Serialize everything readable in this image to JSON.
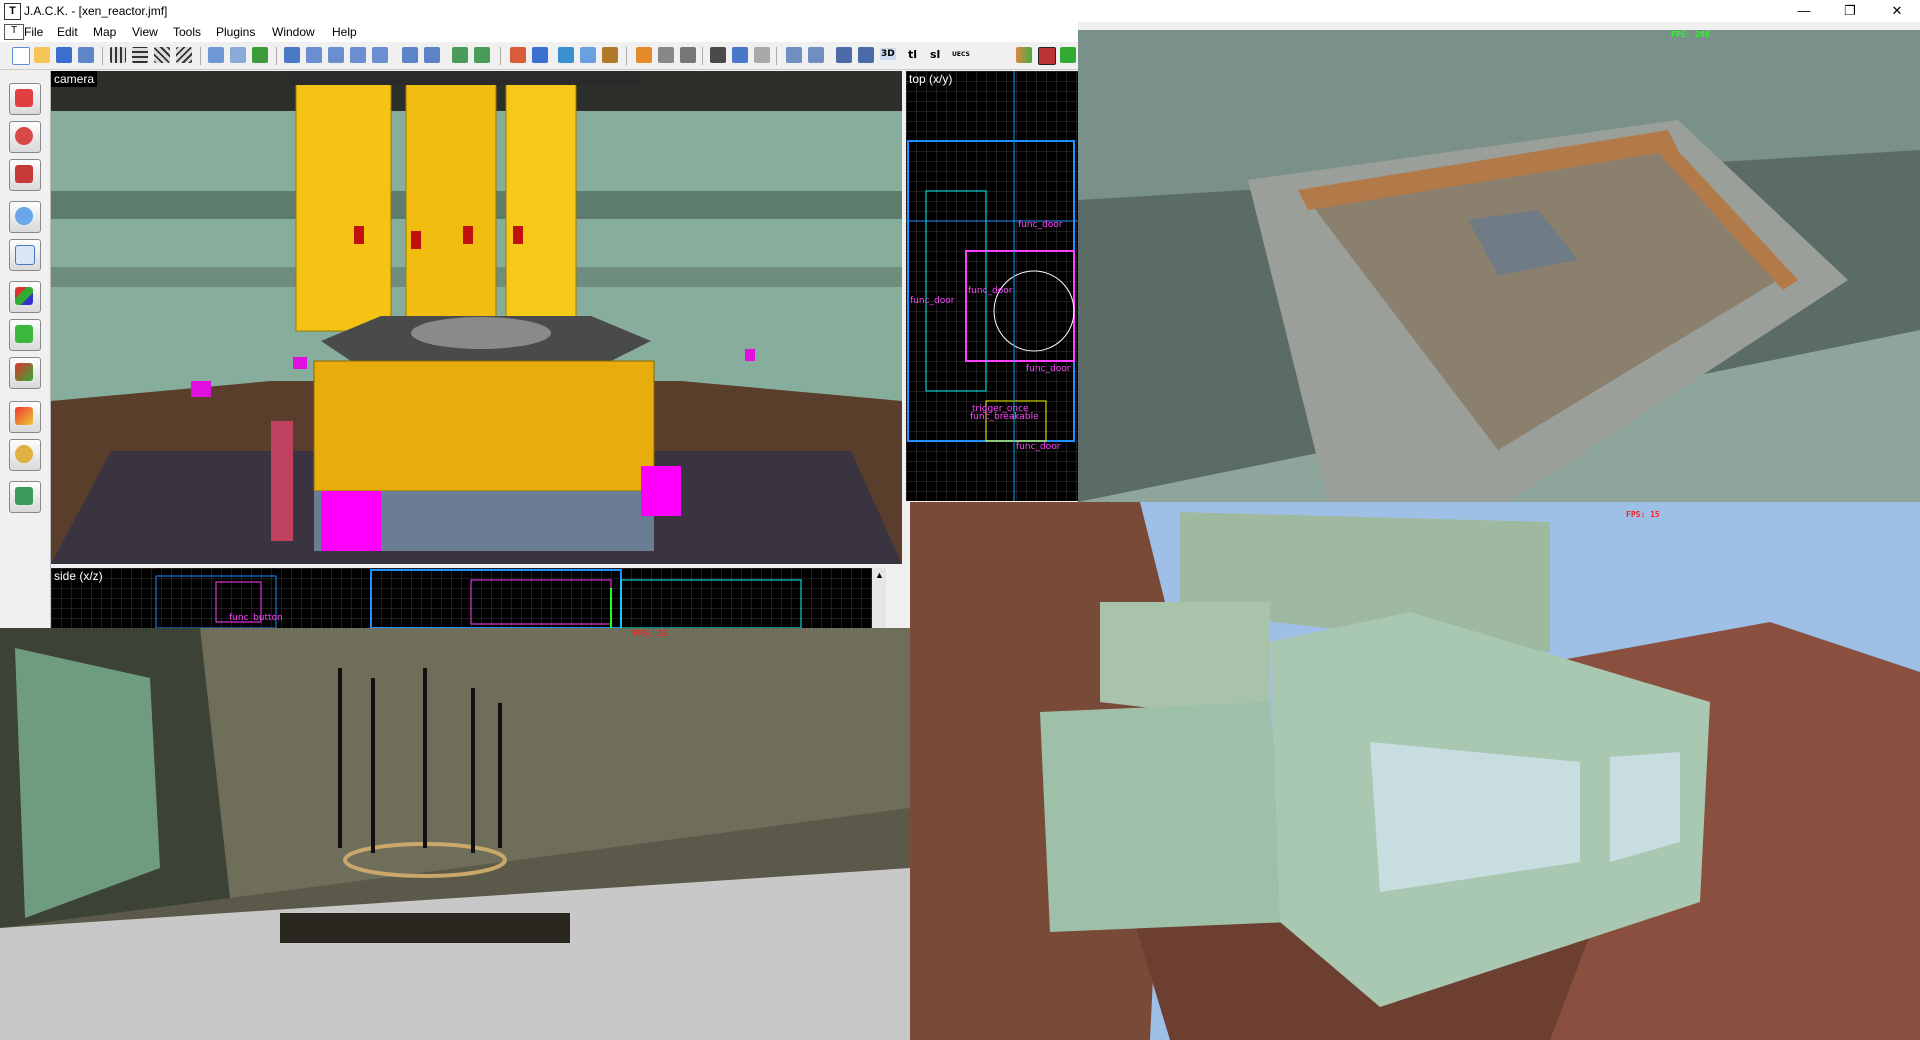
{
  "window": {
    "icon_letter": "T",
    "title": "J.A.C.K. - [xen_reactor.jmf]",
    "minimize": "—",
    "restore": "❐",
    "close": "✕"
  },
  "menu": [
    "File",
    "Edit",
    "Map",
    "View",
    "Tools",
    "Plugins",
    "Window",
    "Help"
  ],
  "toolbar_text": {
    "three_d": "3D",
    "tl": "tl",
    "sl": "sl",
    "uecs": "UECS"
  },
  "left_tools": [
    "selection-tool",
    "magnify-tool",
    "camera-tool",
    "entity-tool",
    "block-tool",
    "texture-application-tool",
    "apply-texture-tool",
    "replace-texture-tool",
    "decal-tool",
    "path-tool",
    "vertex-tool"
  ],
  "viewports": {
    "camera": {
      "label": "camera"
    },
    "top": {
      "label": "top (x/y)",
      "labels": [
        "func_door",
        "func_door",
        "func_door",
        "func_door",
        "trigger_once",
        "func_breakable",
        "func_door"
      ]
    },
    "side": {
      "label": "side (x/z)",
      "labels": [
        "func_button"
      ]
    }
  },
  "screenshots": {
    "arena": {
      "fps": "FPS: 248"
    },
    "hall": {
      "fps": "FPS: 13"
    },
    "outpost": {
      "fps": "FPS: 15"
    }
  },
  "colors": {
    "grid_bg": "#000000",
    "grid_line": "#3a3a3a",
    "brush_blue": "#1e90ff",
    "brush_pink": "#ff40ff",
    "brush_cyan": "#00ffff",
    "entity_text": "#ff44ff",
    "fps_red": "#ff2020",
    "fps_green": "#20ff20",
    "reactor_yellow": "#f4c313",
    "tank_green": "#8fb3a3",
    "marker_magenta": "#ff00ff"
  }
}
